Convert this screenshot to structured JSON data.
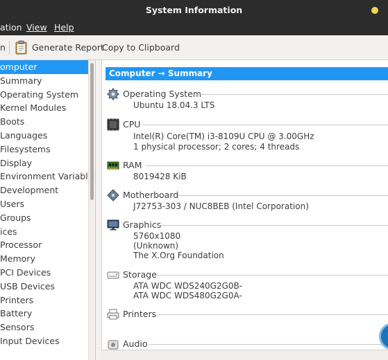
{
  "window": {
    "title": "System Information"
  },
  "menu": {
    "file_partial": "ation",
    "view": "View",
    "help": "Help"
  },
  "toolbar": {
    "left_partial": "n",
    "generate_report": "Generate Report",
    "copy": "Copy to Clipboard",
    "report_icon": "clipboard-icon"
  },
  "sidebar": {
    "items": [
      {
        "label": "omputer",
        "selected": true
      },
      {
        "label": "Summary"
      },
      {
        "label": "Operating System"
      },
      {
        "label": "Kernel Modules"
      },
      {
        "label": "Boots"
      },
      {
        "label": "Languages"
      },
      {
        "label": "Filesystems"
      },
      {
        "label": "Display"
      },
      {
        "label": "Environment Variables"
      },
      {
        "label": "Development"
      },
      {
        "label": "Users"
      },
      {
        "label": "Groups"
      },
      {
        "label": "ices"
      },
      {
        "label": "Processor"
      },
      {
        "label": "Memory"
      },
      {
        "label": "PCI Devices"
      },
      {
        "label": "USB Devices"
      },
      {
        "label": "Printers"
      },
      {
        "label": "Battery"
      },
      {
        "label": "Sensors"
      },
      {
        "label": "Input Devices"
      }
    ]
  },
  "main": {
    "header": "Computer → Summary",
    "sections": [
      {
        "name": "Operating System",
        "icon": "gear-icon",
        "values": [
          "Ubuntu 18.04.3 LTS"
        ]
      },
      {
        "name": "CPU",
        "icon": "cpu-chip-icon",
        "values": [
          "Intel(R) Core(TM) i3-8109U CPU @ 3.00GHz",
          "1 physical processor; 2 cores; 4 threads"
        ]
      },
      {
        "name": "RAM",
        "icon": "memory-stick-icon",
        "values": [
          "8019428 KiB"
        ]
      },
      {
        "name": "Motherboard",
        "icon": "motherboard-icon",
        "values": [
          "J72753-303 / NUC8BEB (Intel Corporation)"
        ]
      },
      {
        "name": "Graphics",
        "icon": "monitor-icon",
        "values": [
          "5760x1080",
          "(Unknown)",
          "The X.Org Foundation"
        ]
      },
      {
        "name": "Storage",
        "icon": "hard-drive-icon",
        "values": [
          "ATA WDC WDS240G2G0B-",
          "ATA WDC WDS480G2G0A-"
        ]
      },
      {
        "name": "Printers",
        "icon": "printer-icon",
        "values": []
      },
      {
        "name": "Audio",
        "icon": "speaker-icon",
        "values": []
      }
    ]
  }
}
